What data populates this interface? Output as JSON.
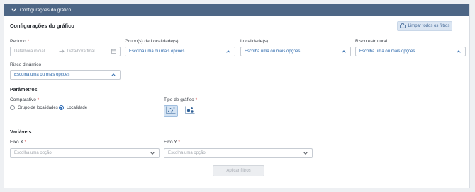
{
  "header": {
    "title": "Configurações do gráfico"
  },
  "section": {
    "title": "Configurações do gráfico",
    "clear_filters_label": "Limpar todos os filtros"
  },
  "filters": {
    "periodo": {
      "label": "Período",
      "required": "*",
      "start_placeholder": "Data/hora inicial",
      "end_placeholder": "Data/hora final"
    },
    "grupo_localidade": {
      "label": "Grupo(s) de Localidade(s)",
      "value": "Escolha uma ou mais opções"
    },
    "localidade": {
      "label": "Localidade(s)",
      "value": "Escolha uma ou mais opções"
    },
    "risco_estrutural": {
      "label": "Risco estrutural",
      "value": "Escolha uma ou mais opções"
    },
    "risco_dinamico": {
      "label": "Risco dinâmico",
      "value": "Escolha uma ou mais opções"
    }
  },
  "parametros": {
    "title": "Parâmetros",
    "comparativo": {
      "label": "Comparativo",
      "required": "*",
      "options": [
        {
          "label": "Grupo de localidades",
          "selected": false
        },
        {
          "label": "Localidade",
          "selected": true
        }
      ]
    },
    "tipo_grafico": {
      "label": "Tipo de gráfico",
      "required": "*",
      "options": [
        {
          "icon": "scatter-chart-icon",
          "selected": true
        },
        {
          "icon": "bubble-chart-icon",
          "selected": false
        }
      ]
    }
  },
  "variaveis": {
    "title": "Variáveis",
    "eixo_x": {
      "label": "Eixo X",
      "required": "*",
      "placeholder": "Escolha uma opção"
    },
    "eixo_y": {
      "label": "Eixo Y",
      "required": "*",
      "placeholder": "Escolha uma opção"
    }
  },
  "apply_label": "Aplicar filtros",
  "colors": {
    "header": "#4d6685",
    "accent": "#2e6bb5",
    "value_text": "#2563a8"
  }
}
